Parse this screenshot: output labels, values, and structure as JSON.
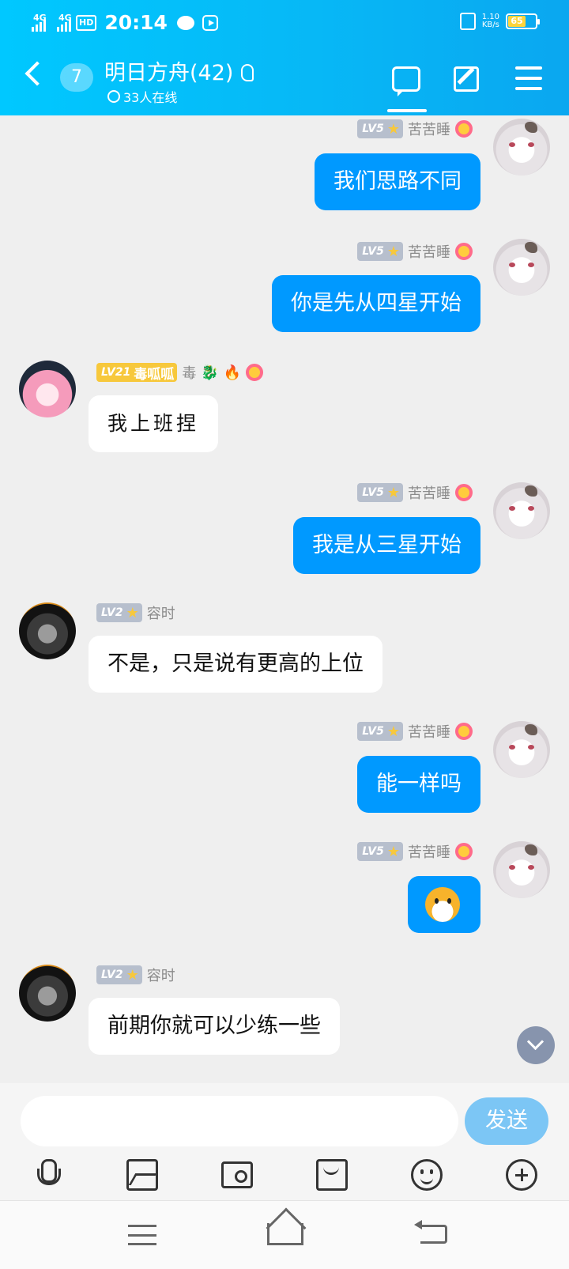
{
  "status_bar": {
    "signal1": "4G",
    "signal2": "4G",
    "hd": "HD",
    "time": "20:14",
    "speed_value": "1.10",
    "speed_unit": "KB/s",
    "battery": "65"
  },
  "header": {
    "unread_count": "7",
    "group_title": "明日方舟(42)",
    "online": "33人在线",
    "icons": [
      "back-icon",
      "ear-icon",
      "chat-icon",
      "edit-icon",
      "menu-icon"
    ]
  },
  "messages": [
    {
      "side": "out",
      "level": "LV5",
      "name": "苦苦睡",
      "text": "我们思路不同"
    },
    {
      "side": "out",
      "level": "LV5",
      "name": "苦苦睡",
      "text": "你是先从四星开始"
    },
    {
      "side": "in",
      "level": "LV21",
      "title": "毒呱呱",
      "name": "毒",
      "text": "我上班捏"
    },
    {
      "side": "out",
      "level": "LV5",
      "name": "苦苦睡",
      "text": "我是从三星开始"
    },
    {
      "side": "in",
      "level": "LV2",
      "name": "容时",
      "text": "不是，只是说有更高的上位"
    },
    {
      "side": "out",
      "level": "LV5",
      "name": "苦苦睡",
      "text": "能一样吗"
    },
    {
      "side": "out",
      "level": "LV5",
      "name": "苦苦睡",
      "text": "",
      "emoji": "doge-face"
    },
    {
      "side": "in",
      "level": "LV2",
      "name": "容时",
      "text": "前期你就可以少练一些"
    }
  ],
  "composer": {
    "input_value": "",
    "send_label": "发送",
    "tools": [
      "microphone-icon",
      "image-icon",
      "camera-icon",
      "red-packet-icon",
      "emoji-icon",
      "plus-icon"
    ]
  },
  "colors": {
    "header_start": "#00c8ff",
    "header_end": "#0aa7f0",
    "outgoing_bubble": "#0099ff",
    "incoming_bubble": "#ffffff",
    "level_badge": "#b7bfcd",
    "gold_badge": "#f7c83c",
    "send_button": "#7cc6f5"
  }
}
